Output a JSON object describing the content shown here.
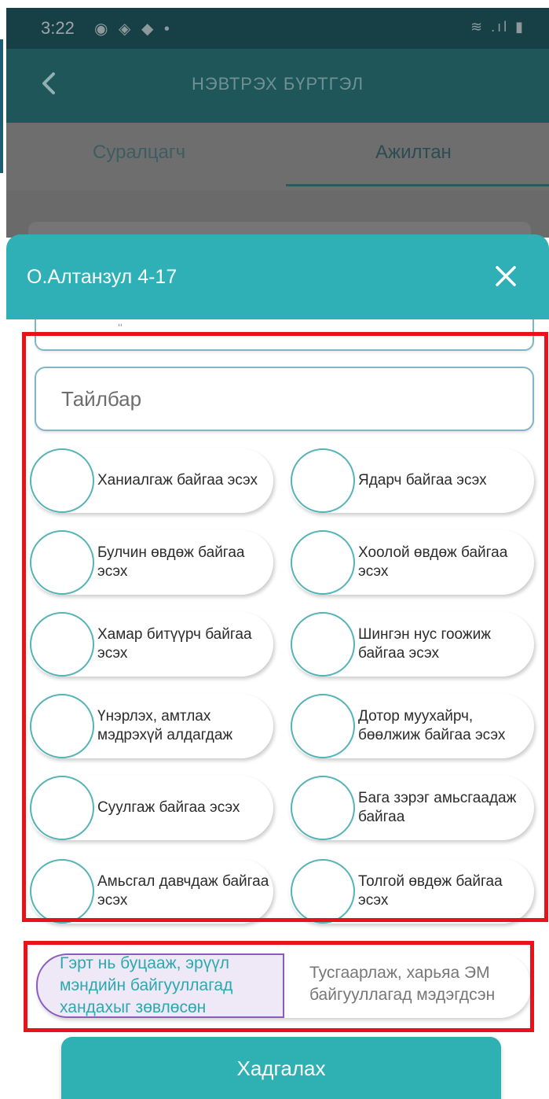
{
  "status_bar": {
    "time": "3:22",
    "left_icons": "◉ ◈ ◆ •",
    "right_icons": "≋ .ıl ▮"
  },
  "app_bar": {
    "title": "НЭВТРЭХ БҮРТГЭЛ"
  },
  "tabs": [
    {
      "label": "Суралцагч"
    },
    {
      "label": "Ажилтан"
    }
  ],
  "modal": {
    "title": "О.Алтанзул  4-17",
    "prev_field_fragment": "‘‘",
    "description_placeholder": "Тайлбар",
    "symptoms": [
      {
        "label": "Ханиалгаж байгаа эсэх"
      },
      {
        "label": "Ядарч байгаа эсэх"
      },
      {
        "label": "Булчин өвдөж байгаа эсэх"
      },
      {
        "label": "Хоолой өвдөж байгаа эсэх"
      },
      {
        "label": "Хамар битүүрч байгаа эсэх"
      },
      {
        "label": "Шингэн нус гоожиж байгаа эсэх"
      },
      {
        "label": "Үнэрлэх, амтлах мэдрэхүй алдагдаж"
      },
      {
        "label": "Дотор муухайрч, бөөлжиж байгаа эсэх"
      },
      {
        "label": "Суулгаж байгаа эсэх"
      },
      {
        "label": "Бага зэрэг амьсгаадаж байгаа"
      },
      {
        "label": "Амьсгал давчдаж байгаа эсэх"
      },
      {
        "label": "Толгой өвдөж байгаа эсэх"
      }
    ],
    "outcome": {
      "selected": "Гэрт нь буцааж, эрүүл мэндийн байгууллагад хандахыг зөвлөсөн",
      "other": "Тусгаарлаж, харьяа ЭМ байгууллагад мэдэгдсэн"
    },
    "save_label": "Хадгалах"
  },
  "colors": {
    "accent": "#2fafb6",
    "highlight": "#e8121b",
    "selected_border": "#8a5cbf",
    "selected_bg": "#efe8f6"
  }
}
